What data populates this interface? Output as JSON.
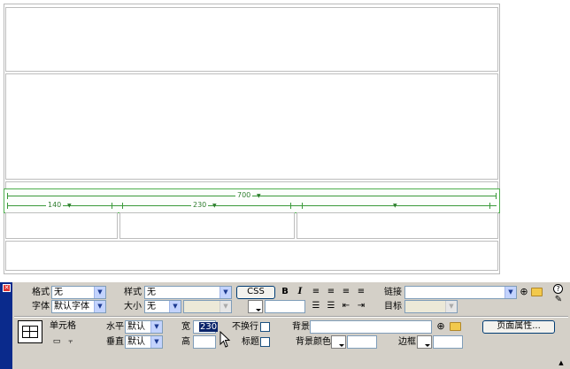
{
  "canvas": {
    "guides": {
      "table_width": "700",
      "col1_width": "140",
      "col2_width": "230"
    }
  },
  "inspector": {
    "format_label": "格式",
    "format_value": "无",
    "font_label": "字体",
    "font_value": "默认字体",
    "style_label": "样式",
    "style_value": "无",
    "size_label": "大小",
    "size_value": "无",
    "css_button": "CSS",
    "bold": "B",
    "italic": "I",
    "link_label": "链接",
    "link_value": "",
    "target_label": "目标",
    "target_value": "",
    "cell_label": "单元格",
    "horz_label": "水平",
    "horz_value": "默认",
    "vert_label": "垂直",
    "vert_value": "默认",
    "width_label": "宽",
    "width_value": "230",
    "height_label": "高",
    "height_value": "",
    "nowrap_label": "不换行",
    "header_label": "标题",
    "bg_label": "背景",
    "bg_value": "",
    "bgcolor_label": "背景颜色",
    "bgcolor_value": "",
    "border_label": "边框",
    "border_value": "",
    "page_props_button": "页面属性...",
    "help_icon": "?"
  }
}
